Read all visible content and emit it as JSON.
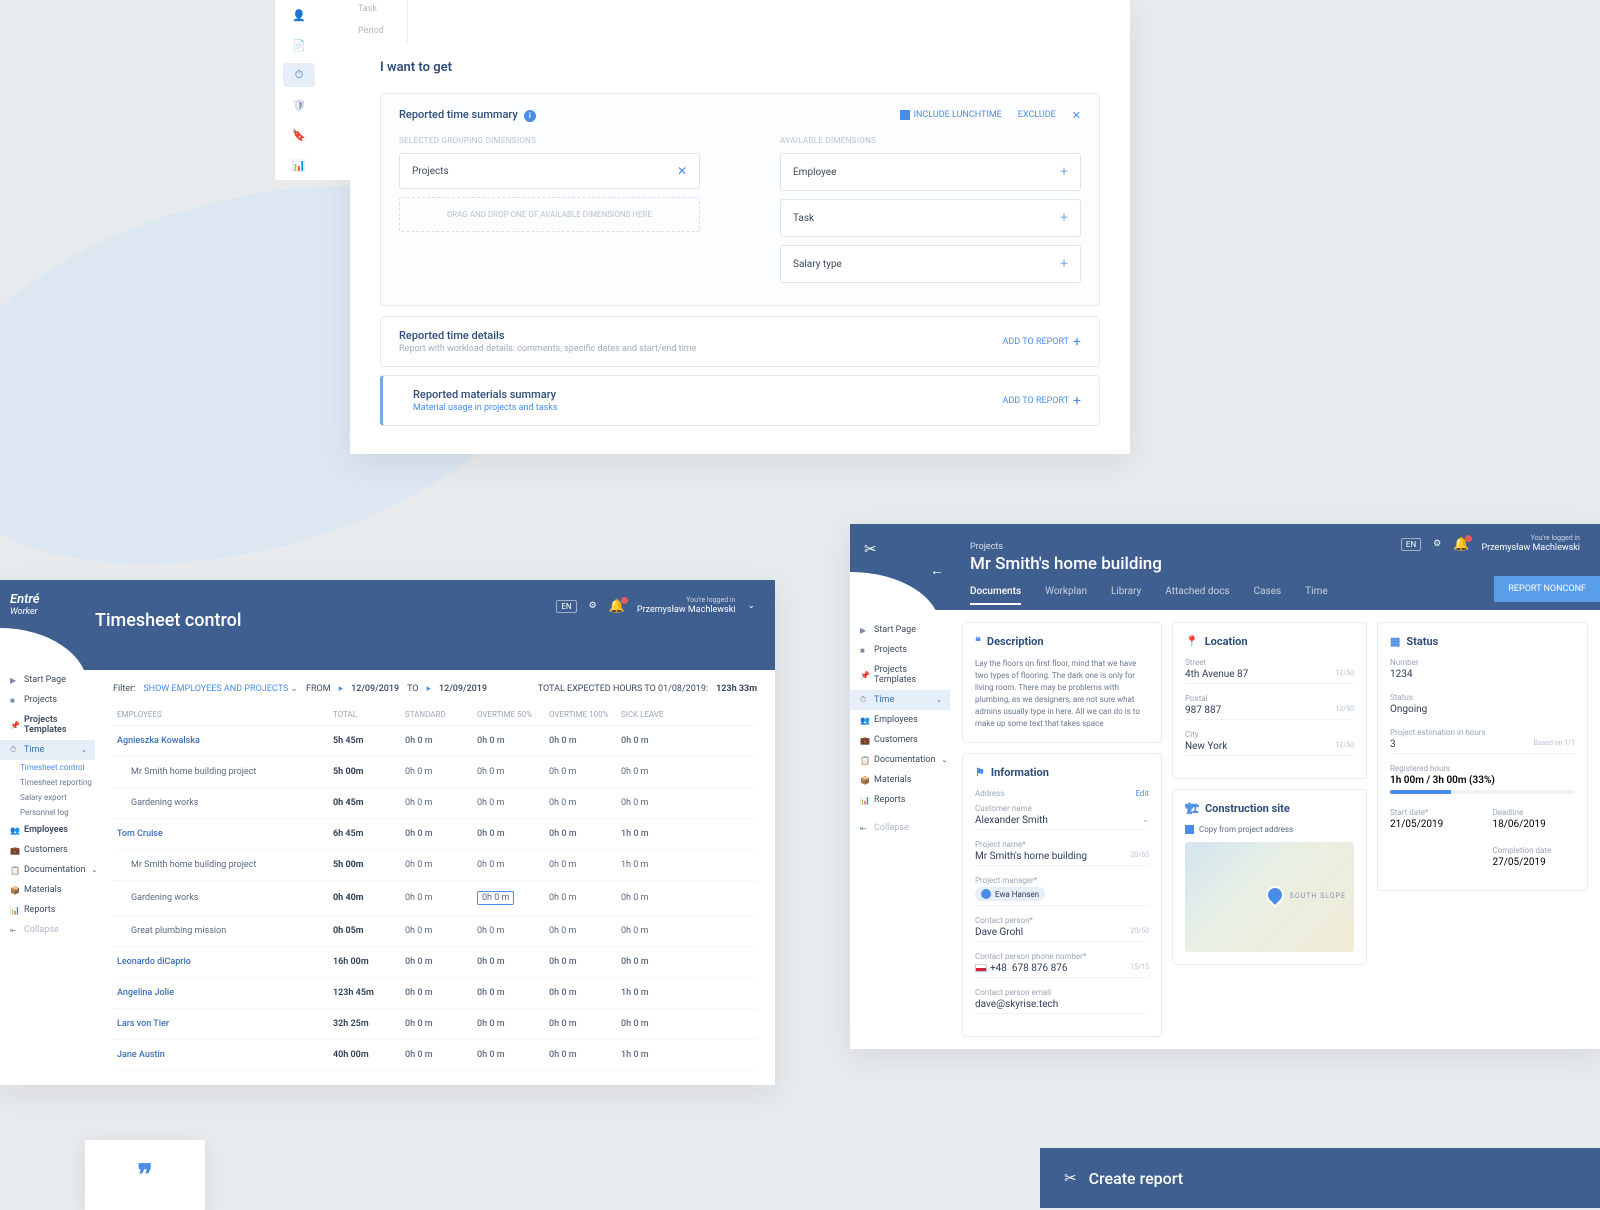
{
  "panel1": {
    "tabs": [
      "Task",
      "Period"
    ],
    "title": "I want to get",
    "summary": {
      "title": "Reported time summary",
      "include_lunch": "INCLUDE LUNCHTIME",
      "exclude": "EXCLUDE",
      "selected_label": "SELECTED GROUPING DIMENSIONS",
      "available_label": "AVAILABLE DIMENSIONS",
      "selected": [
        "Projects"
      ],
      "drop_hint": "DRAG AND DROP ONE OF AVAILABLE DIMENSIONS HERE",
      "available": [
        "Employee",
        "Task",
        "Salary type"
      ]
    },
    "details": {
      "title": "Reported time details",
      "sub": "Report with workload details: comments, specific dates and start/end time",
      "btn": "ADD TO REPORT"
    },
    "materials": {
      "title": "Reported materials summary",
      "sub": "Material usage in projects and tasks",
      "btn": "ADD TO REPORT"
    }
  },
  "panel2": {
    "brand": "Entré",
    "brand_sub": "Worker",
    "title": "Timesheet control",
    "lang": "EN",
    "user_label": "You're logged in",
    "user_name": "Przemysław Machlewski",
    "nav": {
      "start": "Start Page",
      "projects": "Projects",
      "templates": "Projects Templates",
      "time": "Time",
      "time_sub": [
        "Timesheet control",
        "Timesheet reporting",
        "Salary export",
        "Personnel log"
      ],
      "employees": "Employees",
      "customers": "Customers",
      "documentation": "Documentation",
      "materials": "Materials",
      "reports": "Reports",
      "collapse": "Collapse"
    },
    "filter": {
      "label": "Filter:",
      "show": "SHOW EMPLOYEES AND PROJECTS",
      "from": "FROM",
      "from_date": "12/09/2019",
      "to": "TO",
      "to_date": "12/09/2019",
      "total": "TOTAL EXPECTED HOURS TO 01/08/2019:",
      "total_val": "123h 33m"
    },
    "columns": [
      "EMPLOYEES",
      "TOTAL",
      "STANDARD",
      "OVERTIME 50%",
      "OVERTIME 100%",
      "SICK LEAVE"
    ],
    "rows": [
      {
        "name": "Agnieszka Kowalska",
        "type": "head",
        "vals": [
          "5h 45m",
          "0h 0 m",
          "0h 0 m",
          "0h 0 m",
          "0h 0 m"
        ]
      },
      {
        "name": "Mr Smith home building project",
        "type": "sub",
        "vals": [
          "5h 00m",
          "0h 0 m",
          "0h 0 m",
          "0h 0 m",
          "0h 0 m"
        ]
      },
      {
        "name": "Gardening works",
        "type": "sub",
        "vals": [
          "0h 45m",
          "0h 0 m",
          "0h 0 m",
          "0h 0 m",
          "0h 0 m"
        ]
      },
      {
        "name": "Tom Cruise",
        "type": "head",
        "vals": [
          "6h 45m",
          "0h 0 m",
          "0h 0 m",
          "0h 0 m",
          "1h 0 m"
        ]
      },
      {
        "name": "Mr Smith home building project",
        "type": "sub",
        "vals": [
          "5h 00m",
          "0h 0 m",
          "0h 0 m",
          "0h 0 m",
          "1h 0 m"
        ]
      },
      {
        "name": "Gardening works",
        "type": "sub",
        "vals": [
          "0h 40m",
          "0h 0 m",
          "0h 0 m",
          "0h 0 m",
          "0h 0 m"
        ],
        "hl": 2
      },
      {
        "name": "Great plumbing mission",
        "type": "sub",
        "vals": [
          "0h 05m",
          "0h 0 m",
          "0h 0 m",
          "0h 0 m",
          "0h 0 m"
        ]
      },
      {
        "name": "Leonardo diCaprio",
        "type": "head",
        "vals": [
          "16h 00m",
          "0h 0 m",
          "0h 0 m",
          "0h 0 m",
          "0h 0 m"
        ]
      },
      {
        "name": "Angelina Jolie",
        "type": "head",
        "vals": [
          "123h 45m",
          "0h 0 m",
          "0h 0 m",
          "0h 0 m",
          "1h 0 m"
        ]
      },
      {
        "name": "Lars von Tier",
        "type": "head",
        "vals": [
          "32h 25m",
          "0h 0 m",
          "0h 0 m",
          "0h 0 m",
          "0h 0 m"
        ]
      },
      {
        "name": "Jane Austin",
        "type": "head",
        "vals": [
          "40h 00m",
          "0h 0 m",
          "0h 0 m",
          "0h 0 m",
          "1h 0 m"
        ]
      }
    ]
  },
  "panel3": {
    "crumb": "Projects",
    "title": "Mr Smith's home building",
    "lang": "EN",
    "user_label": "You're logged in",
    "user_name": "Przemysław Machlewski",
    "tabs": [
      "Documents",
      "Workplan",
      "Library",
      "Attached docs",
      "Cases",
      "Time"
    ],
    "report_btn": "REPORT NONCONF",
    "nav": {
      "start": "Start Page",
      "projects": "Projects",
      "templates": "Projects Templates",
      "time": "Time",
      "employees": "Employees",
      "customers": "Customers",
      "documentation": "Documentation",
      "materials": "Materials",
      "reports": "Reports",
      "collapse": "Collapse"
    },
    "description": {
      "title": "Description",
      "body": "Lay the floors on first floor, mind that we have two types of flooring. The dark one is only for living room. There may be problems with plumbing, as we designers, are not sure what admins usually type in here. All we can do is to make up some text that takes space"
    },
    "information": {
      "title": "Information",
      "act_l": "Address",
      "act_r": "Edit",
      "customer_lbl": "Customer name",
      "customer": "Alexander Smith",
      "project_lbl": "Project name*",
      "project": "Mr Smith's home building",
      "project_cnt": "20/50",
      "pm_lbl": "Project manager*",
      "pm": "Ewa Hansen",
      "contact_lbl": "Contact person*",
      "contact": "Dave Grohl",
      "contact_cnt": "20/50",
      "phone_lbl": "Contact person phone number*",
      "phone_prefix": "+48",
      "phone": "678 876 876",
      "phone_cnt": "15/15",
      "email_lbl": "Contact person email",
      "email": "dave@skyrise.tech"
    },
    "location": {
      "title": "Location",
      "street_lbl": "Street",
      "street": "4th Avenue 87",
      "street_cnt": "12/50",
      "postal_lbl": "Postal",
      "postal": "987 887",
      "postal_cnt": "12/50",
      "city_lbl": "City",
      "city": "New York",
      "city_cnt": "12/50"
    },
    "construction": {
      "title": "Construction site",
      "copy": "Copy from project address",
      "map_label": "SOUTH SLOPE"
    },
    "status": {
      "title": "Status",
      "num_lbl": "Number",
      "num": "1234",
      "status_lbl": "Status",
      "status": "Ongoing",
      "est_lbl": "Project estimation in hours",
      "est": "3",
      "est_note": "Based on 1/1",
      "reg_lbl": "Registered hours",
      "reg": "1h 00m / 3h 00m (33%)",
      "start_lbl": "Start date*",
      "start": "21/05/2019",
      "deadline_lbl": "Deadline",
      "deadline": "18/06/2019",
      "completion_lbl": "Completion date",
      "completion": "27/05/2019"
    }
  },
  "panel4": {
    "title": "Create report"
  }
}
